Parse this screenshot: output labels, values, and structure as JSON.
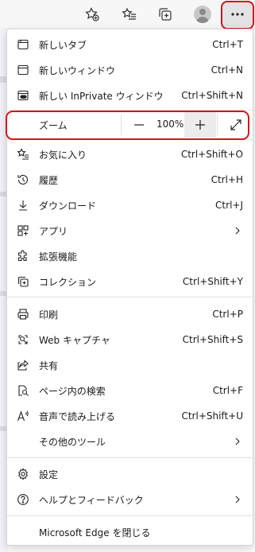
{
  "menu": {
    "new_tab": {
      "label": "新しいタブ",
      "shortcut": "Ctrl+T"
    },
    "new_window": {
      "label": "新しいウィンドウ",
      "shortcut": "Ctrl+N"
    },
    "new_inprivate": {
      "label": "新しい InPrivate ウィンドウ",
      "shortcut": "Ctrl+Shift+N"
    },
    "zoom": {
      "label": "ズーム",
      "value": "100%"
    },
    "favorites": {
      "label": "お気に入り",
      "shortcut": "Ctrl+Shift+O"
    },
    "history": {
      "label": "履歴",
      "shortcut": "Ctrl+H"
    },
    "downloads": {
      "label": "ダウンロード",
      "shortcut": "Ctrl+J"
    },
    "apps": {
      "label": "アプリ"
    },
    "extensions": {
      "label": "拡張機能"
    },
    "collections": {
      "label": "コレクション",
      "shortcut": "Ctrl+Shift+Y"
    },
    "print": {
      "label": "印刷",
      "shortcut": "Ctrl+P"
    },
    "web_capture": {
      "label": "Web キャプチャ",
      "shortcut": "Ctrl+Shift+S"
    },
    "share": {
      "label": "共有"
    },
    "find": {
      "label": "ページ内の検索",
      "shortcut": "Ctrl+F"
    },
    "read_aloud": {
      "label": "音声で読み上げる",
      "shortcut": "Ctrl+Shift+U"
    },
    "more_tools": {
      "label": "その他のツール"
    },
    "settings": {
      "label": "設定"
    },
    "help": {
      "label": "ヘルプとフィードバック"
    },
    "close_edge": {
      "label": "Microsoft Edge を閉じる"
    }
  },
  "colors": {
    "highlight": "#d6141a",
    "accent": "#1a1a1a"
  }
}
